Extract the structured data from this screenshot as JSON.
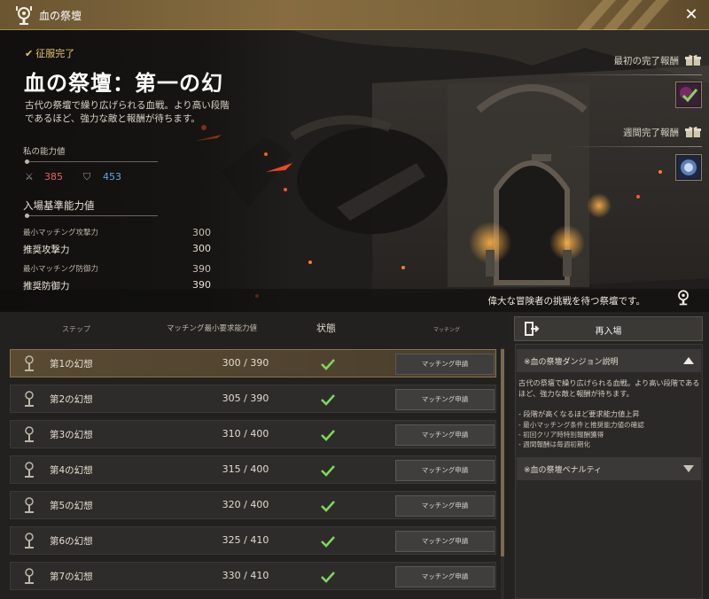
{
  "window": {
    "title": "血の祭壇",
    "close_label": "✕"
  },
  "hero": {
    "status": "征服完了",
    "title": "血の祭壇：第一の幻",
    "description": "古代の祭壇で繰り広げられる血戦。より高い段階であるほど、強力な敵と報酬が待ちます。",
    "my_power_label": "私の能力値",
    "my_attack": "385",
    "my_defense": "453",
    "entry_label": "入場基準能力値",
    "requirements": [
      {
        "label": "最小マッチング攻撃力",
        "value": "300",
        "size": "small"
      },
      {
        "label": "推奨攻撃力",
        "value": "300",
        "size": "big"
      },
      {
        "label": "最小マッチング防御力",
        "value": "390",
        "size": "small"
      },
      {
        "label": "推奨防御力",
        "value": "390",
        "size": "big"
      }
    ],
    "first_reward_label": "最初の完了報酬",
    "weekly_reward_label": "週間完了報酬",
    "tagline": "偉大な冒険者の挑戦を待つ祭壇です。"
  },
  "table": {
    "headers": {
      "step": "ステップ",
      "requirement": "マッチング最小要求能力値",
      "status": "状態",
      "matching": "マッチング"
    },
    "rows": [
      {
        "name": "第1の幻想",
        "req": "300 / 390",
        "button": "マッチング申請",
        "selected": true
      },
      {
        "name": "第2の幻想",
        "req": "305 / 390",
        "button": "マッチング申請"
      },
      {
        "name": "第3の幻想",
        "req": "310 / 400",
        "button": "マッチング申請"
      },
      {
        "name": "第4の幻想",
        "req": "315 / 400",
        "button": "マッチング申請"
      },
      {
        "name": "第5の幻想",
        "req": "320 / 400",
        "button": "マッチング申請"
      },
      {
        "name": "第6の幻想",
        "req": "325 / 410",
        "button": "マッチング申請"
      },
      {
        "name": "第7の幻想",
        "req": "330 / 410",
        "button": "マッチング申請"
      }
    ]
  },
  "panel": {
    "reenter_label": "再入場",
    "explanation_title": "※血の祭壇ダンジョン説明",
    "explanation_intro": "古代の祭壇で繰り広げられる血戦。より高い段階であるほど、強力な敵と報酬が待ちます。",
    "explanation_points": [
      "- 段階が高くなるほど要求能力値上昇",
      "- 最小マッチング条件と推奨能力値の確認",
      "- 初回クリア時特別報酬獲得",
      "- 週間報酬は毎週初期化"
    ],
    "penalty_title": "※血の祭壇ペナルティ"
  },
  "colors": {
    "accent": "#866c40",
    "check": "#7ed957",
    "attack": "#e6655a",
    "defense": "#5fa6e0"
  },
  "icons": {
    "close": "close-icon",
    "logo": "altar-emblem-icon",
    "check": "check-icon",
    "gift": "gift-icon",
    "reenter": "door-exit-icon",
    "step": "altar-step-icon"
  }
}
